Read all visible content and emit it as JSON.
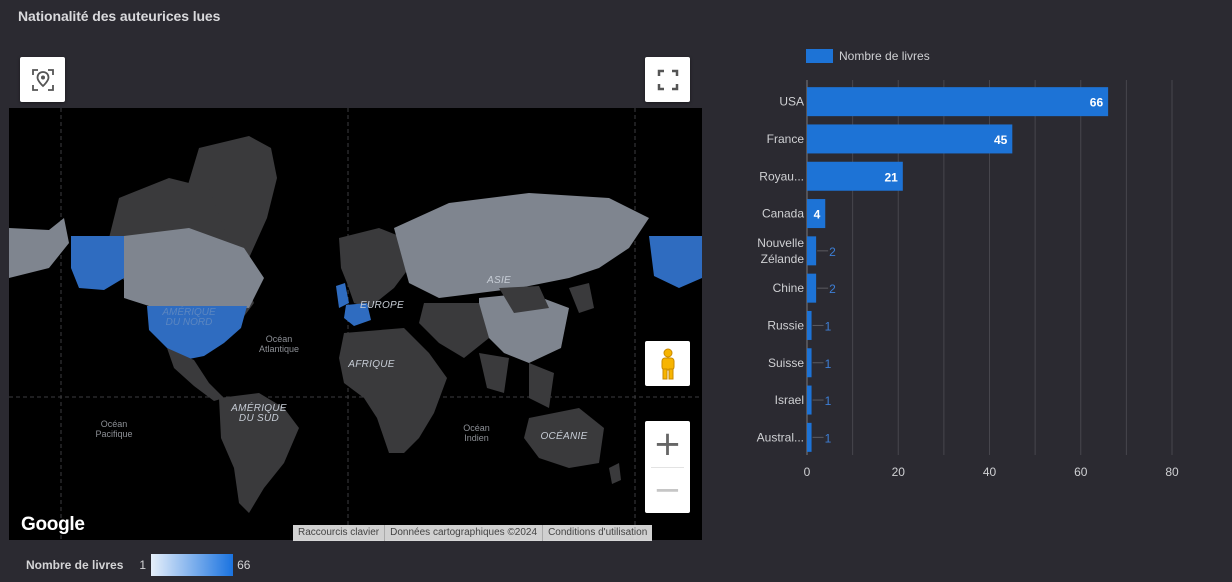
{
  "title": "Nationalité des auteurices lues",
  "map": {
    "labels": {
      "amerique_nord": "AMÉRIQUE\nDU NORD",
      "ocean_atlantique": "Océan\nAtlantique",
      "europe": "EUROPE",
      "asie": "ASIE",
      "afrique": "AFRIQUE",
      "amerique_sud": "AMÉRIQUE\nDU SUD",
      "ocean_pacifique": "Océan\nPacifique",
      "ocean_indien": "Océan\nIndien",
      "oceanie": "OCÉANIE"
    },
    "google": "Google",
    "attribution": [
      "Raccourcis clavier",
      "Données cartographiques ©2024",
      "Conditions d'utilisation"
    ],
    "legend_title": "Nombre de livres",
    "legend_min": "1",
    "legend_max": "66",
    "highlight_color": "#2f6cc0",
    "land_color": "#7f858f",
    "dark_land_color": "#3a3a3c"
  },
  "bar_chart_legend": "Nombre de livres",
  "chart_data": {
    "type": "bar",
    "orientation": "horizontal",
    "categories": [
      "USA",
      "France",
      "Royau...",
      "Canada",
      "Nouvelle Zélande",
      "Chine",
      "Russie",
      "Suisse",
      "Israel",
      "Austral..."
    ],
    "series": [
      {
        "name": "Nombre de livres",
        "values": [
          66,
          45,
          21,
          4,
          2,
          2,
          1,
          1,
          1,
          1
        ],
        "color": "#1d73d6"
      }
    ],
    "data_labels": [
      "66",
      "45",
      "21",
      "4",
      "2",
      "2",
      "1",
      "1",
      "1",
      "1"
    ],
    "xlim": [
      0,
      80
    ],
    "xticks": [
      "0",
      "20",
      "40",
      "60",
      "80"
    ],
    "grid": true,
    "legend": "top-left"
  }
}
